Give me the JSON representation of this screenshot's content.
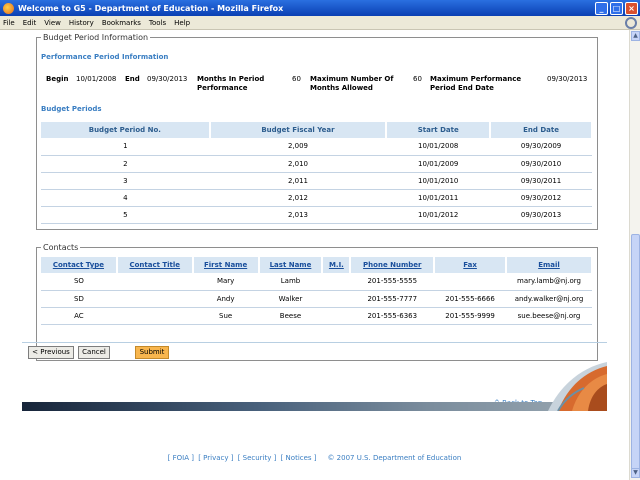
{
  "window": {
    "title": "Welcome to G5 - Department of Education - Mozilla Firefox",
    "minimize": "_",
    "maximize": "□",
    "close": "×"
  },
  "menu": [
    "File",
    "Edit",
    "View",
    "History",
    "Bookmarks",
    "Tools",
    "Help"
  ],
  "budget_section": {
    "legend": "Budget Period Information",
    "performance_title": "Performance Period Information",
    "begin_label": "Begin",
    "begin_value": "10/01/2008",
    "end_label": "End",
    "end_value": "09/30/2013",
    "months_label_1": "Months In Period",
    "months_label_2": "Performance",
    "months_value": "60",
    "max_months_label_1": "Maximum Number Of",
    "max_months_label_2": "Months Allowed",
    "max_months_value": "60",
    "max_perf_label_1": "Maximum Performance",
    "max_perf_label_2": "Period End Date",
    "max_perf_value": "09/30/2013",
    "periods_title": "Budget Periods",
    "columns": [
      "Budget Period No.",
      "Budget Fiscal Year",
      "Start Date",
      "End Date"
    ],
    "rows": [
      [
        "1",
        "2,009",
        "10/01/2008",
        "09/30/2009"
      ],
      [
        "2",
        "2,010",
        "10/01/2009",
        "09/30/2010"
      ],
      [
        "3",
        "2,011",
        "10/01/2010",
        "09/30/2011"
      ],
      [
        "4",
        "2,012",
        "10/01/2011",
        "09/30/2012"
      ],
      [
        "5",
        "2,013",
        "10/01/2012",
        "09/30/2013"
      ]
    ]
  },
  "contacts_section": {
    "legend": "Contacts",
    "columns": [
      "Contact Type",
      "Contact Title",
      "First Name",
      "Last Name",
      "M.I.",
      "Phone Number",
      "Fax",
      "Email"
    ],
    "rows": [
      [
        "SO",
        "",
        "Mary",
        "Lamb",
        "",
        "201-555-5555",
        "",
        "mary.lamb@nj.org"
      ],
      [
        "SD",
        "",
        "Andy",
        "Walker",
        "",
        "201-555-7777",
        "201-555-6666",
        "andy.walker@nj.org"
      ],
      [
        "AC",
        "",
        "Sue",
        "Beese",
        "",
        "201-555-6363",
        "201-555-9999",
        "sue.beese@nj.org"
      ]
    ]
  },
  "buttons": {
    "previous": "< Previous",
    "cancel": "Cancel",
    "submit": "Submit"
  },
  "back_to_top": "^ Back to Top",
  "footer": {
    "links": [
      "[ FOIA ]",
      "[ Privacy ]",
      "[ Security ]",
      "[ Notices ]"
    ],
    "copyright": "© 2007 U.S. Department of Education"
  }
}
